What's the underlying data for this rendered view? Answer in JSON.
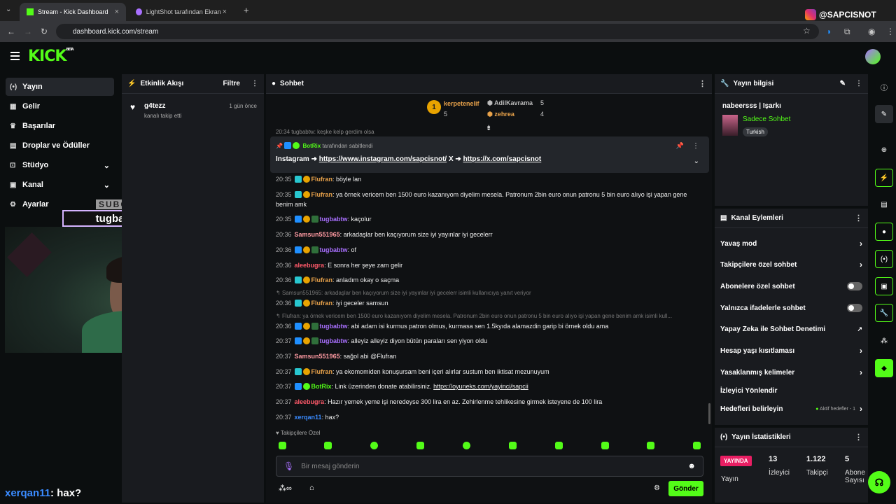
{
  "browser": {
    "tabs": [
      {
        "title": "Stream - Kick Dashboard"
      },
      {
        "title": "LightShot tarafından Ekran Gör"
      }
    ],
    "url": "dashboard.kick.com/stream"
  },
  "watermark": {
    "handle": "@SAPCISNOT"
  },
  "header": {
    "logo_text": "KICK",
    "logo_beta": "BETA"
  },
  "sidebar": {
    "items": [
      {
        "label": "Yayın",
        "icon": "broadcast-icon"
      },
      {
        "label": "Gelir",
        "icon": "revenue-icon"
      },
      {
        "label": "Başarılar",
        "icon": "trophy-icon"
      },
      {
        "label": "Droplar ve Ödüller",
        "icon": "gift-icon"
      },
      {
        "label": "Stüdyo",
        "icon": "studio-icon"
      },
      {
        "label": "Kanal",
        "icon": "channel-icon"
      },
      {
        "label": "Ayarlar",
        "icon": "gear-icon"
      }
    ]
  },
  "overlay": {
    "subs_label": "SUBG",
    "name": "tugbabtw",
    "bottom_user": "xerqan11",
    "bottom_text": ": hax?"
  },
  "activity": {
    "title": "Etkinlik Akışı",
    "filter_label": "Filtre",
    "events": [
      {
        "user": "g4tezz",
        "action": "kanalı takip etti",
        "time": "1 gün önce"
      }
    ]
  },
  "chat": {
    "title": "Sohbet",
    "leaderboard": [
      {
        "name": "kerpetenelif",
        "count": "5"
      },
      {
        "name": "AdilKavrama",
        "count": "5"
      },
      {
        "name": "zehrea",
        "count": "4"
      }
    ],
    "partial_top": "20:34 tugbabtw: keşke kelp gerdim olsa",
    "pinned": {
      "by_user": "BotRix",
      "by_text": "tarafından sabitlendi",
      "prefix": "Instagram ➜",
      "link1": "https://www.instagram.com/sapcisnot/",
      "mid": "X ➜",
      "link2": "https://x.com/sapcisnot"
    },
    "messages": [
      {
        "time": "20:35",
        "user": "Flufran",
        "color": "#e8a24a",
        "text": "böyle lan"
      },
      {
        "time": "20:35",
        "user": "Flufran",
        "color": "#e8a24a",
        "text": "ya örnek vericem ben 1500 euro kazanıyom diyelim mesela. Patronum 2bin euro onun patronu 5 bin euro alıyo işi yapan gene benim amk"
      },
      {
        "time": "20:35",
        "user": "tugbabtw",
        "color": "#a970ff",
        "text": "kaçolur"
      },
      {
        "time": "20:36",
        "user": "Samsun551965",
        "color": "#ff9aa2",
        "text": "arkadaşlar ben kaçıyorum size iyi yayınlar iyi gecelerr"
      },
      {
        "time": "20:36",
        "user": "tugbabtw",
        "color": "#a970ff",
        "text": "of"
      },
      {
        "time": "20:36",
        "user": "aleebugra",
        "color": "#ff5a6a",
        "text": "E sonra her şeye zam gelir"
      },
      {
        "time": "20:36",
        "user": "Flufran",
        "color": "#e8a24a",
        "text": "anladım okay o saçma"
      },
      {
        "time": "20:36",
        "user": "Flufran",
        "color": "#e8a24a",
        "text": "iyi geceler samsun"
      },
      {
        "time": "20:36",
        "user": "tugbabtw",
        "color": "#a970ff",
        "text": "abi adam isi kurmus patron olmus, kurmasa sen 1.5kyıda alamazdin garip bi örnek oldu ama"
      },
      {
        "time": "20:37",
        "user": "tugbabtw",
        "color": "#a970ff",
        "text": "alleyiz alleyiz diyon bütün paraları sen yiyon oldu"
      },
      {
        "time": "20:37",
        "user": "Samsun551965",
        "color": "#ff9aa2",
        "text": "sağol abi @Flufran"
      },
      {
        "time": "20:37",
        "user": "Flufran",
        "color": "#e8a24a",
        "text": "ya ekomomiden konuşursam beni içeri alırlar sustum ben iktisat mezunuyum"
      },
      {
        "time": "20:37",
        "user": "BotRix",
        "color": "#53fc18",
        "text": "Link üzerinden donate atabilirsiniz.",
        "link": "https://oyuneks.com/yayinci/sapcii"
      },
      {
        "time": "20:37",
        "user": "aleebugra",
        "color": "#ff5a6a",
        "text": "Hazır yemek yeme işi neredeyse 300 lira en az. Zehirlenme tehlikesine girmek isteyene de 100 lira"
      },
      {
        "time": "20:37",
        "user": "xerqan11",
        "color": "#3a8bff",
        "text": "hax?"
      }
    ],
    "replies": [
      "Samsun551965: arkadaşlar ben kaçıyorum size iyi yayınlar iyi gecelerr isimli kullanıcıya yanıt veriyor",
      "Flufran: ya örnek vericem ben 1500 euro kazanıyom diyelim mesela. Patronum 2bin euro onun patronu 5 bin euro alıyo işi yapan gene benim amk isimli kull..."
    ],
    "followers_only": "Takipçilere Özel",
    "input_placeholder": "Bir mesaj gönderin",
    "send_label": "Gönder"
  },
  "stream_info": {
    "title": "Yayın bilgisi",
    "stream_title": "nabeersss | Işarkı",
    "category": "Sadece Sohbet",
    "tag": "Turkish"
  },
  "channel_actions": {
    "title": "Kanal Eylemleri",
    "items": [
      {
        "label": "Yavaş mod",
        "control": "chevron"
      },
      {
        "label": "Takipçilere özel sohbet",
        "control": "chevron"
      },
      {
        "label": "Abonelere özel sohbet",
        "control": "toggle"
      },
      {
        "label": "Yalnızca ifadelerle sohbet",
        "control": "toggle"
      },
      {
        "label": "Yapay Zeka ile Sohbet Denetimi",
        "control": "external"
      },
      {
        "label": "Hesap yaşı kısıtlaması",
        "control": "chevron"
      },
      {
        "label": "Yasaklanmış kelimeler",
        "control": "chevron"
      },
      {
        "label": "İzleyici Yönlendir",
        "control": "none"
      },
      {
        "label": "Hedefleri belirleyin",
        "control": "chevron",
        "note": "Aktif hedefler - 1"
      }
    ]
  },
  "stream_stats": {
    "title": "Yayın İstatistikleri",
    "live_label": "YAYINDA",
    "live_caption": "Yayın",
    "viewers": "13",
    "viewers_label": "İzleyici",
    "followers": "1.122",
    "followers_label": "Takipçi",
    "subs": "5",
    "subs_label": "Abone Sayısı"
  },
  "colors": {
    "accent": "#53fc18",
    "live": "#e91e63"
  }
}
